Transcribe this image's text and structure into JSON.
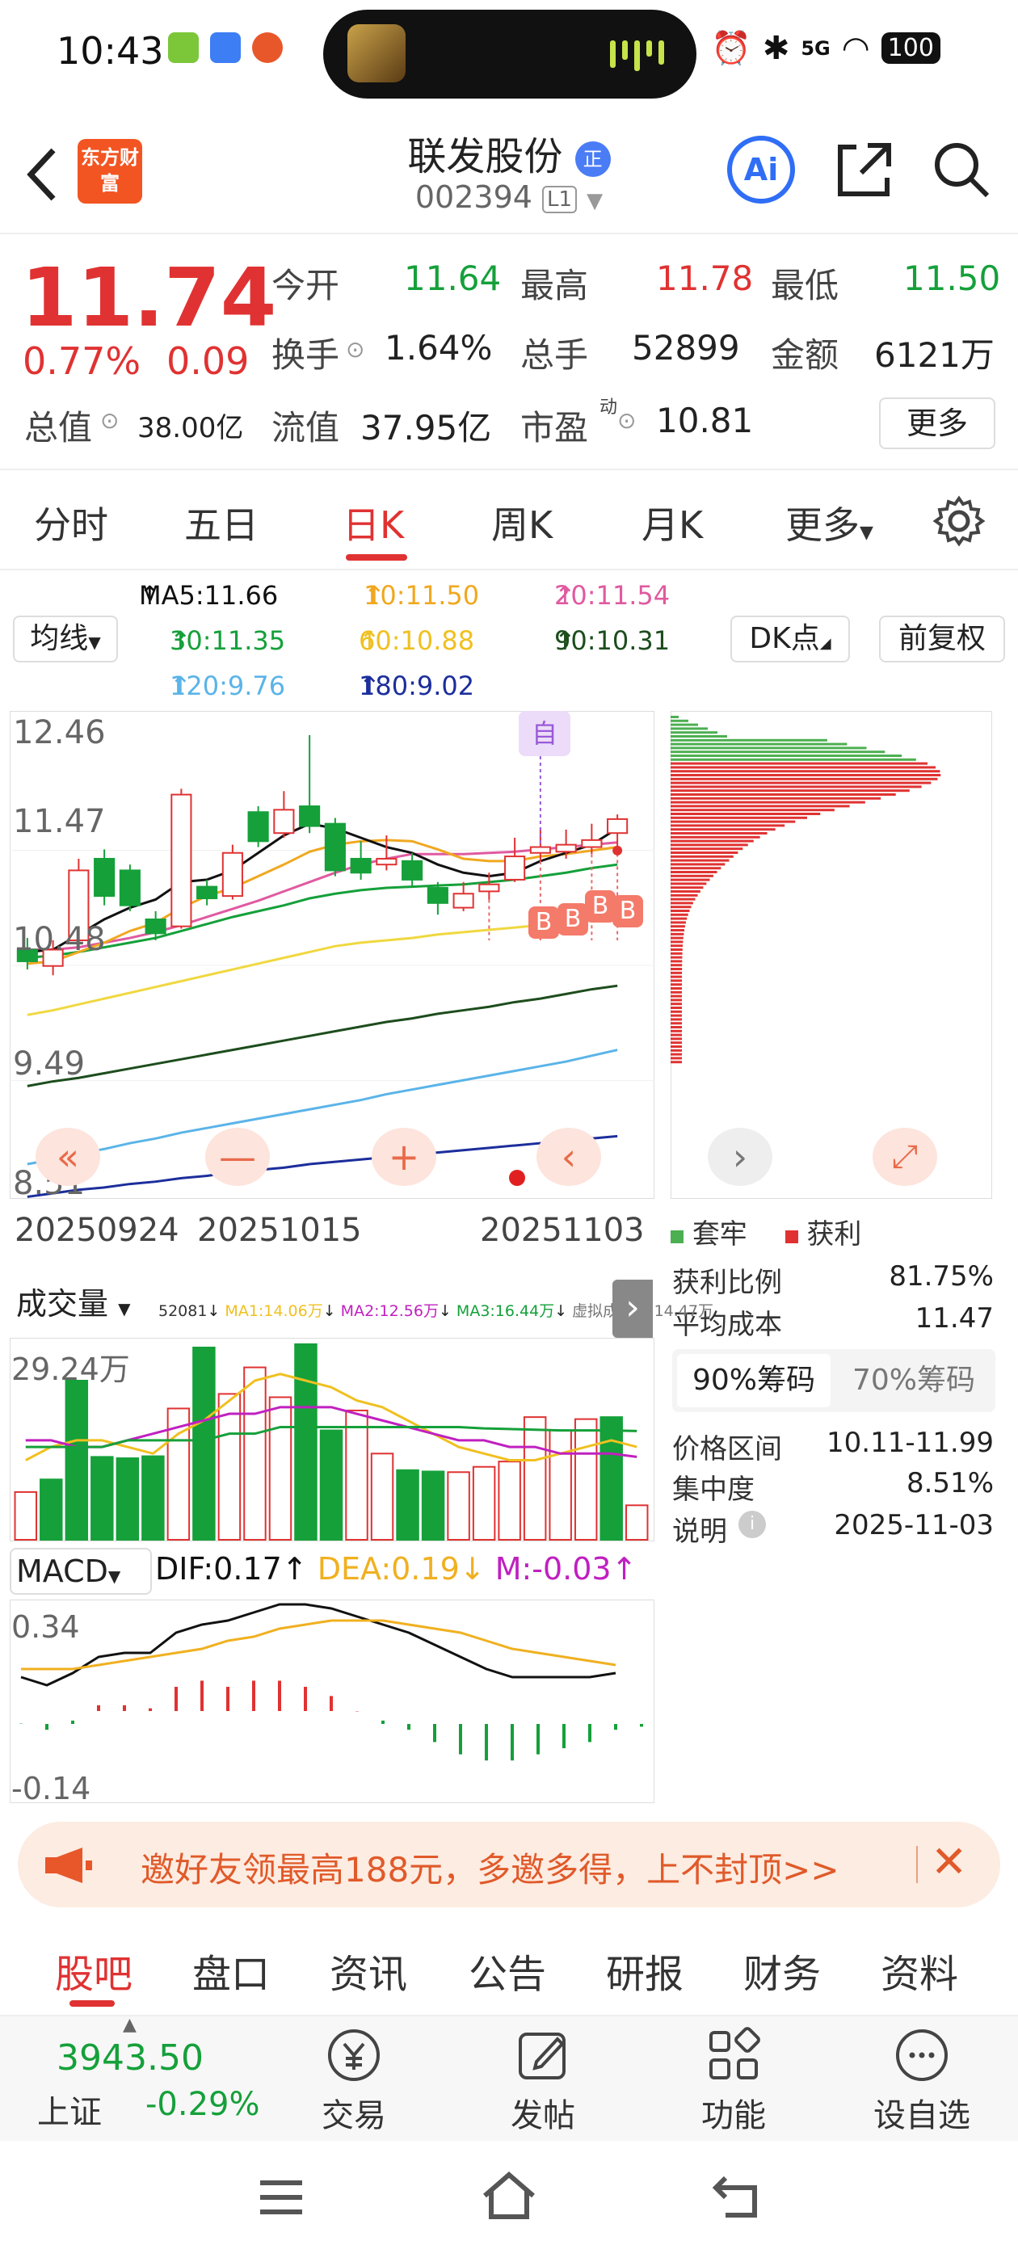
{
  "status": {
    "time": "10:43",
    "battery": "100",
    "network": "5G"
  },
  "header": {
    "logo": "东方财富",
    "stock_name": "联发股份",
    "badge": "正",
    "stock_code": "002394",
    "level": "L1",
    "ai_label": "Ai"
  },
  "quote": {
    "price": "11.74",
    "change_pct": "0.77%",
    "change": "0.09",
    "open_label": "今开",
    "open": "11.64",
    "high_label": "最高",
    "high": "11.78",
    "low_label": "最低",
    "low": "11.50",
    "turnover_label": "换手",
    "turnover": "1.64%",
    "volume_label": "总手",
    "volume": "52899",
    "amount_label": "金额",
    "amount": "6121万",
    "mktcap_label": "总值",
    "mktcap": "38.00亿",
    "float_label": "流值",
    "float": "37.95亿",
    "pe_label": "市盈",
    "pe_sup": "动",
    "pe": "10.81",
    "more_label": "更多"
  },
  "tabs": [
    "分时",
    "五日",
    "日K",
    "周K",
    "月K",
    "更多"
  ],
  "active_tab": "日K",
  "ma": {
    "ma5": "MA5:11.66",
    "ma10": "10:11.50",
    "ma20": "20:11.54",
    "ma30": "30:11.35",
    "ma60": "60:10.88",
    "ma90": "90:10.31",
    "ma120": "120:9.76",
    "ma180": "180:9.02",
    "junxian": "均线",
    "dk": "DK点",
    "fq": "前复权",
    "zi": "自",
    "b": "B"
  },
  "colors": {
    "up": "#e03232",
    "down": "#15a03a",
    "ma5": "#111111",
    "ma10": "#f0a820",
    "ma20": "#e05aa0",
    "ma30": "#15a03a",
    "ma60": "#f0d840",
    "ma90": "#1d4d1d",
    "ma120": "#5ab4e8",
    "ma180": "#1c2e9c",
    "accent": "#e03232"
  },
  "chart_data": [
    {
      "type": "candlestick",
      "title": "日K",
      "y_ticks": [
        "12.46",
        "11.47",
        "10.48",
        "9.49",
        "8.51"
      ],
      "x_ticks": [
        "20250924",
        "20251015",
        "20251103"
      ],
      "ylim": [
        8.51,
        12.46
      ],
      "candles": [
        {
          "o": 10.62,
          "c": 10.52,
          "h": 10.72,
          "l": 10.45
        },
        {
          "o": 10.48,
          "c": 10.62,
          "h": 10.7,
          "l": 10.4
        },
        {
          "o": 10.7,
          "c": 11.3,
          "h": 11.4,
          "l": 10.68
        },
        {
          "o": 11.4,
          "c": 11.08,
          "h": 11.48,
          "l": 11.0
        },
        {
          "o": 11.3,
          "c": 11.0,
          "h": 11.35,
          "l": 10.95
        },
        {
          "o": 10.88,
          "c": 10.76,
          "h": 10.95,
          "l": 10.7
        },
        {
          "o": 10.82,
          "c": 11.95,
          "h": 12.0,
          "l": 10.8
        },
        {
          "o": 11.16,
          "c": 11.06,
          "h": 11.22,
          "l": 11.0
        },
        {
          "o": 11.08,
          "c": 11.45,
          "h": 11.52,
          "l": 11.05
        },
        {
          "o": 11.8,
          "c": 11.55,
          "h": 11.85,
          "l": 11.5
        },
        {
          "o": 11.62,
          "c": 11.82,
          "h": 11.98,
          "l": 11.58
        },
        {
          "o": 11.85,
          "c": 11.68,
          "h": 12.46,
          "l": 11.62
        },
        {
          "o": 11.7,
          "c": 11.3,
          "h": 11.75,
          "l": 11.25
        },
        {
          "o": 11.4,
          "c": 11.28,
          "h": 11.55,
          "l": 11.22
        },
        {
          "o": 11.35,
          "c": 11.4,
          "h": 11.6,
          "l": 11.3
        },
        {
          "o": 11.38,
          "c": 11.22,
          "h": 11.45,
          "l": 11.15
        },
        {
          "o": 11.15,
          "c": 11.02,
          "h": 11.2,
          "l": 10.92
        },
        {
          "o": 10.98,
          "c": 11.1,
          "h": 11.2,
          "l": 10.95
        },
        {
          "o": 11.12,
          "c": 11.18,
          "h": 11.28,
          "l": 11.05
        },
        {
          "o": 11.22,
          "c": 11.42,
          "h": 11.58,
          "l": 11.2
        },
        {
          "o": 11.45,
          "c": 11.5,
          "h": 11.66,
          "l": 11.38
        },
        {
          "o": 11.46,
          "c": 11.52,
          "h": 11.65,
          "l": 11.4
        },
        {
          "o": 11.5,
          "c": 11.56,
          "h": 11.7,
          "l": 11.44
        },
        {
          "o": 11.62,
          "c": 11.74,
          "h": 11.78,
          "l": 11.5
        }
      ],
      "series": [
        {
          "name": "MA5",
          "values": [
            10.6,
            10.62,
            10.75,
            10.88,
            10.98,
            11.05,
            11.2,
            11.22,
            11.3,
            11.45,
            11.6,
            11.7,
            11.66,
            11.58,
            11.5,
            11.45,
            11.35,
            11.28,
            11.25,
            11.28,
            11.38,
            11.45,
            11.52,
            11.66
          ]
        },
        {
          "name": "10",
          "values": [
            10.5,
            10.52,
            10.6,
            10.68,
            10.78,
            10.85,
            10.98,
            11.08,
            11.15,
            11.25,
            11.35,
            11.46,
            11.52,
            11.55,
            11.56,
            11.55,
            11.48,
            11.4,
            11.38,
            11.38,
            11.42,
            11.44,
            11.47,
            11.5
          ]
        },
        {
          "name": "20",
          "values": [
            10.62,
            10.62,
            10.64,
            10.68,
            10.72,
            10.77,
            10.83,
            10.9,
            10.97,
            11.04,
            11.12,
            11.2,
            11.28,
            11.35,
            11.4,
            11.44,
            11.44,
            11.44,
            11.45,
            11.46,
            11.48,
            11.5,
            11.52,
            11.54
          ]
        },
        {
          "name": "30",
          "values": [
            10.55,
            10.57,
            10.6,
            10.64,
            10.68,
            10.72,
            10.78,
            10.84,
            10.9,
            10.95,
            11.0,
            11.06,
            11.1,
            11.13,
            11.15,
            11.16,
            11.17,
            11.18,
            11.2,
            11.22,
            11.25,
            11.28,
            11.32,
            11.35
          ]
        },
        {
          "name": "60",
          "values": [
            10.06,
            10.1,
            10.15,
            10.2,
            10.25,
            10.3,
            10.35,
            10.4,
            10.45,
            10.5,
            10.55,
            10.6,
            10.65,
            10.68,
            10.7,
            10.72,
            10.75,
            10.77,
            10.79,
            10.81,
            10.83,
            10.85,
            10.87,
            10.88
          ]
        },
        {
          "name": "90",
          "values": [
            9.45,
            9.49,
            9.52,
            9.56,
            9.6,
            9.64,
            9.68,
            9.72,
            9.76,
            9.8,
            9.84,
            9.88,
            9.92,
            9.96,
            10.0,
            10.03,
            10.07,
            10.1,
            10.13,
            10.17,
            10.2,
            10.24,
            10.28,
            10.31
          ]
        },
        {
          "name": "120",
          "values": [
            8.78,
            8.82,
            8.87,
            8.91,
            8.96,
            9.0,
            9.05,
            9.09,
            9.13,
            9.17,
            9.21,
            9.25,
            9.29,
            9.33,
            9.38,
            9.42,
            9.46,
            9.5,
            9.54,
            9.58,
            9.62,
            9.66,
            9.71,
            9.76
          ]
        },
        {
          "name": "180",
          "values": [
            8.5,
            8.53,
            8.56,
            8.58,
            8.61,
            8.63,
            8.66,
            8.68,
            8.71,
            8.73,
            8.75,
            8.78,
            8.8,
            8.82,
            8.84,
            8.86,
            8.88,
            8.9,
            8.92,
            8.94,
            8.96,
            8.98,
            9.0,
            9.02
          ]
        }
      ]
    },
    {
      "type": "bar",
      "title": "成交量",
      "y_ticks": [
        "29.24万"
      ],
      "ylim": [
        0,
        29.24
      ],
      "values": [
        7.2,
        9.1,
        24.0,
        12.5,
        12.3,
        12.6,
        19.8,
        29.0,
        22.0,
        26.0,
        21.5,
        29.5,
        16.5,
        19.5,
        13.0,
        10.5,
        10.3,
        10.2,
        11.0,
        11.8,
        18.5,
        16.5,
        18.2,
        18.5,
        5.2
      ],
      "up": [
        true,
        false,
        false,
        false,
        false,
        false,
        true,
        false,
        true,
        true,
        true,
        false,
        false,
        true,
        true,
        false,
        false,
        true,
        true,
        true,
        true,
        true,
        true,
        false,
        true
      ],
      "series": [
        {
          "name": "MA1:14.06万",
          "values": [
            12,
            14,
            15,
            15,
            14,
            13,
            16,
            18,
            21,
            24,
            25,
            24,
            23,
            21,
            20,
            18,
            16,
            14,
            13,
            12,
            12,
            13,
            14,
            15,
            14
          ]
        },
        {
          "name": "MA2:12.56万",
          "values": [
            15,
            15,
            14,
            14,
            15,
            16,
            17,
            18,
            19,
            19,
            20,
            20,
            20,
            19,
            18,
            17,
            16,
            15,
            15,
            14,
            14,
            13,
            13,
            13,
            12.5
          ]
        },
        {
          "name": "MA3:16.44万",
          "values": [
            14,
            14,
            14,
            14,
            15,
            15,
            15,
            15,
            16,
            16,
            17,
            17,
            17,
            17,
            17,
            17,
            17,
            17,
            16.8,
            16.7,
            16.6,
            16.5,
            16.5,
            16.5,
            16.4
          ]
        }
      ],
      "legend_prefix": "52081",
      "virtual_label": "虚拟成交量:14.47万"
    },
    {
      "type": "line",
      "title": "MACD",
      "y_ticks": [
        "0.34",
        "-0.14"
      ],
      "ylim": [
        -0.14,
        0.34
      ],
      "series": [
        {
          "name": "DIF:0.17",
          "values": [
            0.16,
            0.14,
            0.17,
            0.21,
            0.22,
            0.22,
            0.27,
            0.29,
            0.3,
            0.32,
            0.34,
            0.34,
            0.33,
            0.31,
            0.29,
            0.27,
            0.24,
            0.21,
            0.18,
            0.16,
            0.16,
            0.16,
            0.16,
            0.17
          ]
        },
        {
          "name": "DEA:0.19",
          "values": [
            0.18,
            0.18,
            0.18,
            0.19,
            0.2,
            0.21,
            0.22,
            0.23,
            0.25,
            0.26,
            0.28,
            0.29,
            0.3,
            0.3,
            0.3,
            0.29,
            0.28,
            0.27,
            0.25,
            0.23,
            0.22,
            0.21,
            0.2,
            0.19
          ]
        },
        {
          "name": "M:-0.03",
          "values": [
            -0.02,
            -0.04,
            -0.01,
            0.04,
            0.04,
            0.03,
            0.1,
            0.12,
            0.1,
            0.12,
            0.12,
            0.1,
            0.07,
            0.02,
            -0.01,
            -0.04,
            -0.08,
            -0.12,
            -0.14,
            -0.14,
            -0.12,
            -0.1,
            -0.08,
            -0.04,
            -0.03
          ]
        }
      ]
    }
  ],
  "chip": {
    "legend_trapped": "套牢",
    "legend_profit": "获利",
    "profit_ratio_label": "获利比例",
    "profit_ratio": "81.75%",
    "avg_cost_label": "平均成本",
    "avg_cost": "11.47",
    "tab90": "90%筹码",
    "tab70": "70%筹码",
    "range_label": "价格区间",
    "range": "10.11-11.99",
    "concentration_label": "集中度",
    "concentration": "8.51%",
    "note_label": "说明",
    "note": "2025-11-03"
  },
  "banner": {
    "text": "邀好友领最高188元，多邀多得，上不封顶>>"
  },
  "subtabs": [
    "股吧",
    "盘口",
    "资讯",
    "公告",
    "研报",
    "财务",
    "资料"
  ],
  "bottom": {
    "index_value": "3943.50",
    "index_name": "上证",
    "index_change": "-0.29%",
    "trade": "交易",
    "post": "发帖",
    "func": "功能",
    "watch": "设自选"
  }
}
